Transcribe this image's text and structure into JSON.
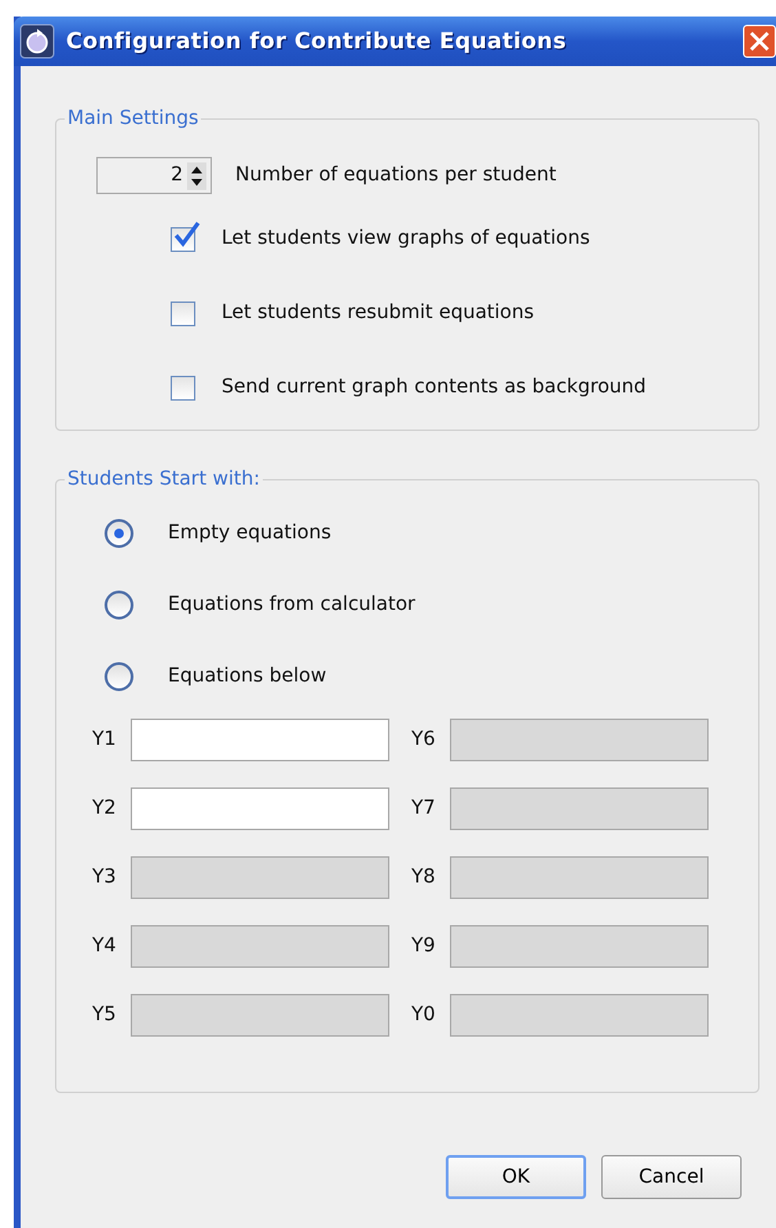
{
  "window": {
    "title": "Configuration for Contribute Equations"
  },
  "main_settings": {
    "title": "Main Settings",
    "spinner": {
      "value": "2",
      "label": "Number of equations per student"
    },
    "options": [
      {
        "label": "Let students view graphs of equations",
        "checked": true
      },
      {
        "label": "Let students resubmit equations",
        "checked": false
      },
      {
        "label": "Send current graph contents as background",
        "checked": false
      }
    ]
  },
  "start_with": {
    "title": "Students Start with:",
    "choices": [
      {
        "label": "Empty equations",
        "selected": true
      },
      {
        "label": "Equations from calculator",
        "selected": false
      },
      {
        "label": "Equations below",
        "selected": false
      }
    ],
    "equations": [
      {
        "label": "Y1",
        "disabled": false
      },
      {
        "label": "Y6",
        "disabled": true
      },
      {
        "label": "Y2",
        "disabled": false
      },
      {
        "label": "Y7",
        "disabled": true
      },
      {
        "label": "Y3",
        "disabled": true
      },
      {
        "label": "Y8",
        "disabled": true
      },
      {
        "label": "Y4",
        "disabled": true
      },
      {
        "label": "Y9",
        "disabled": true
      },
      {
        "label": "Y5",
        "disabled": true
      },
      {
        "label": "Y0",
        "disabled": true
      }
    ]
  },
  "buttons": [
    {
      "label": "OK",
      "default": true
    },
    {
      "label": "Cancel",
      "default": false
    }
  ]
}
